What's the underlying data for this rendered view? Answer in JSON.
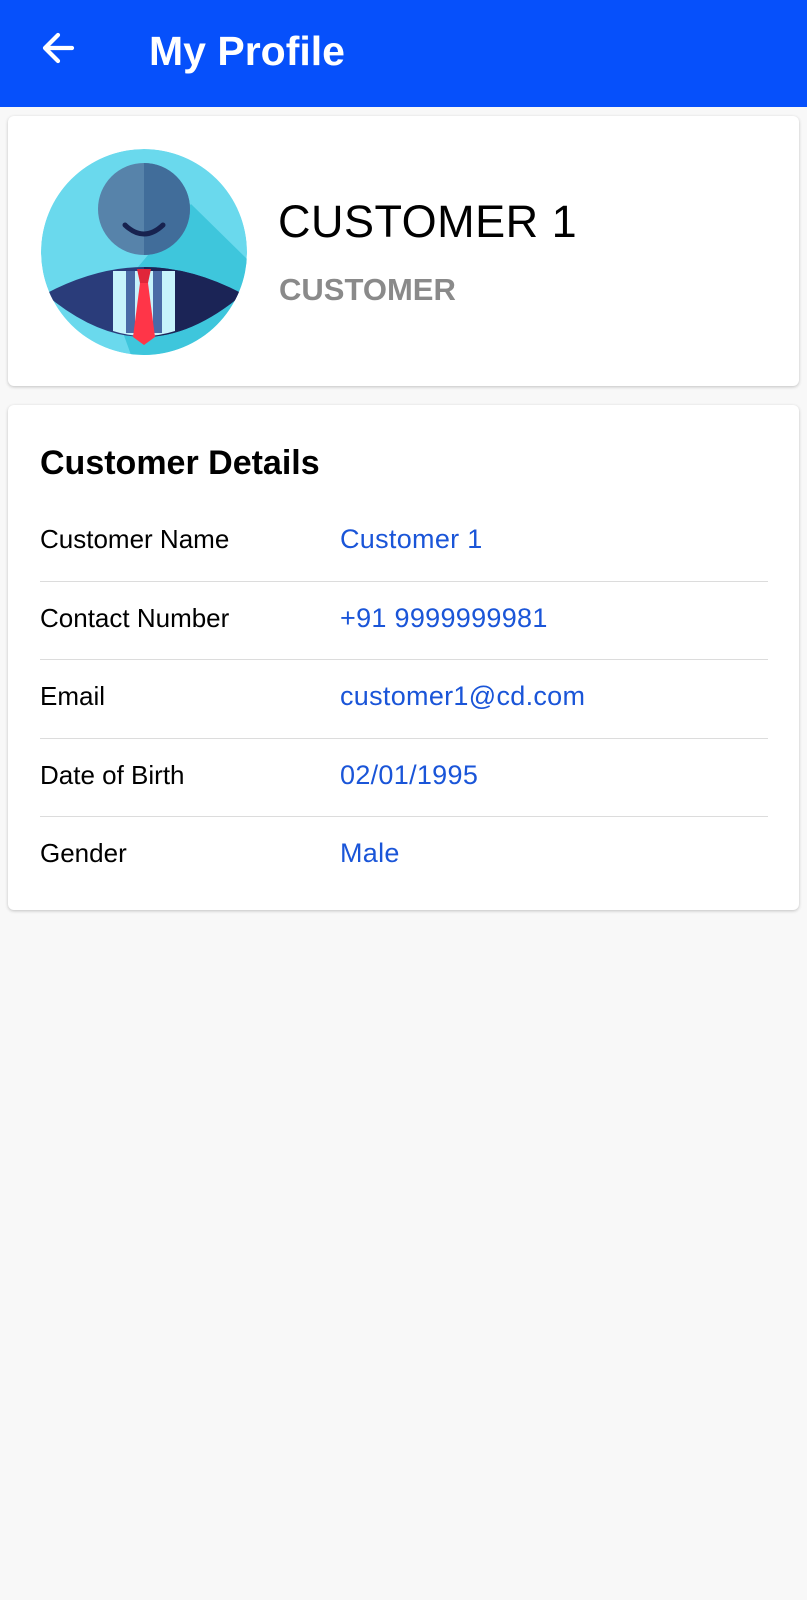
{
  "app_bar": {
    "title": "My Profile",
    "back_icon": "arrow-left-icon",
    "background_color": "#0650fb"
  },
  "profile": {
    "name": "CUSTOMER 1",
    "role": "CUSTOMER",
    "avatar_icon": "businessman-avatar-icon"
  },
  "details": {
    "title": "Customer Details",
    "rows": [
      {
        "label": "Customer Name",
        "value": "Customer 1"
      },
      {
        "label": "Contact Number",
        "value": "+91 9999999981"
      },
      {
        "label": "Email",
        "value": "customer1@cd.com"
      },
      {
        "label": "Date of Birth",
        "value": "02/01/1995"
      },
      {
        "label": "Gender",
        "value": "Male"
      }
    ]
  },
  "colors": {
    "accent": "#0650fb",
    "value_text": "#1a55d8",
    "role_text": "#8a8a8a"
  }
}
